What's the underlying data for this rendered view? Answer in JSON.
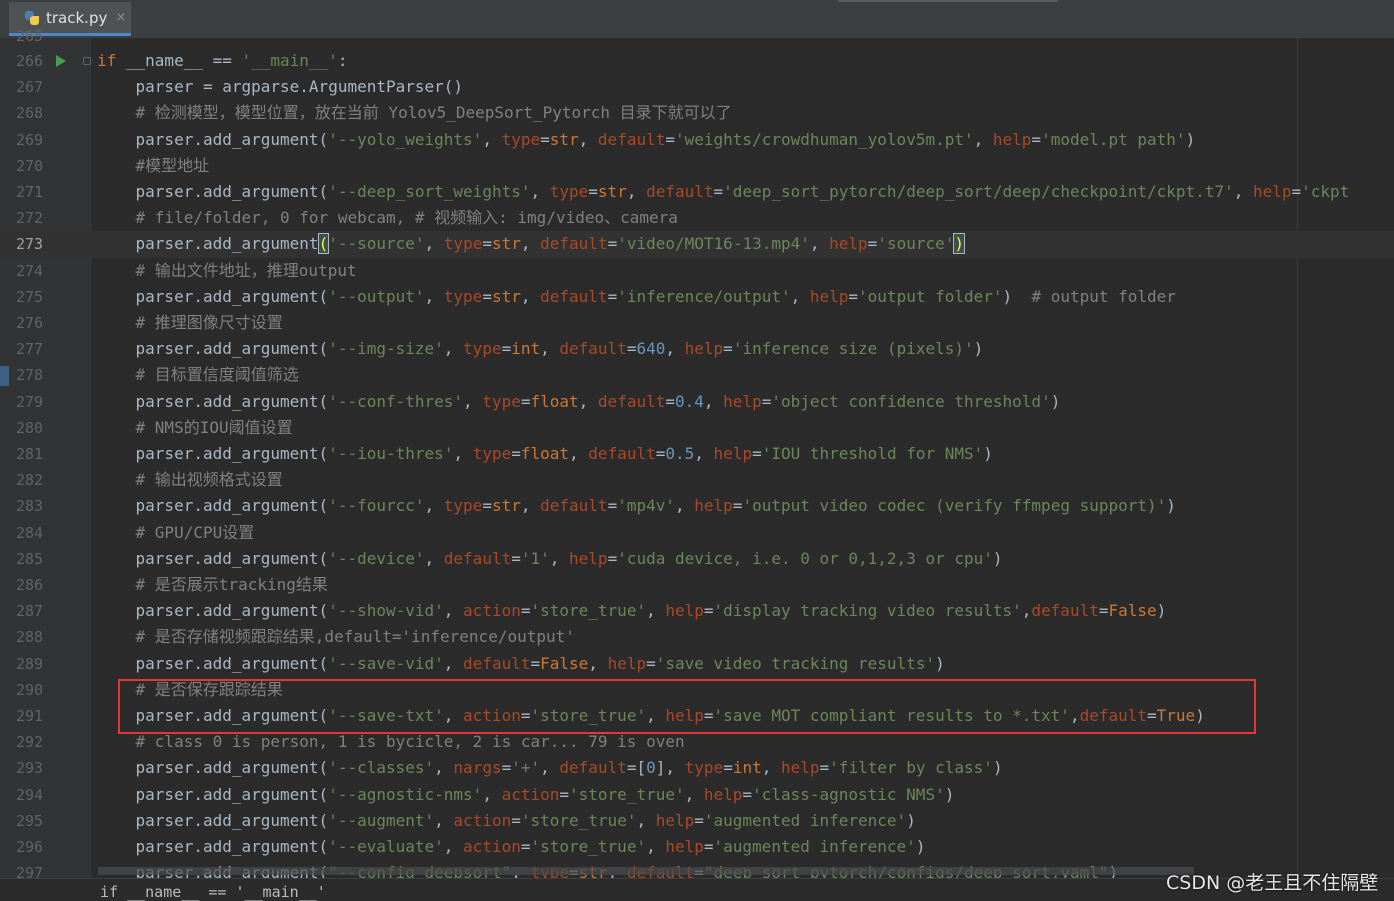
{
  "tab": {
    "file_name": "track.py",
    "close_glyph": "×",
    "icon": "python-file-icon"
  },
  "gutter": {
    "previous_line_number": "265",
    "current_line": "273"
  },
  "lines": [
    {
      "n": "266",
      "tokens": [
        [
          "kw",
          "if"
        ],
        [
          "fn",
          " __name__ == "
        ],
        [
          "str",
          "'__main__'"
        ],
        [
          "fn",
          ":"
        ]
      ]
    },
    {
      "n": "267",
      "tokens": [
        [
          "fn",
          "    parser = argparse.ArgumentParser()"
        ]
      ]
    },
    {
      "n": "268",
      "tokens": [
        [
          "com",
          "    # 检测模型，模型位置，放在当前 "
        ],
        [
          "com",
          "Yolov5_DeepSort_Pytorch"
        ],
        [
          "com",
          " 目录下就可以了"
        ]
      ]
    },
    {
      "n": "269",
      "tokens": [
        [
          "fn",
          "    parser.add_argument("
        ],
        [
          "str",
          "'--yolo_weights'"
        ],
        [
          "fn",
          ", "
        ],
        [
          "kwarg",
          "type"
        ],
        [
          "fn",
          "="
        ],
        [
          "kw2",
          "str"
        ],
        [
          "fn",
          ", "
        ],
        [
          "kwarg",
          "default"
        ],
        [
          "fn",
          "="
        ],
        [
          "str",
          "'weights/crowdhuman_yolov5m.pt'"
        ],
        [
          "fn",
          ", "
        ],
        [
          "kwarg",
          "help"
        ],
        [
          "fn",
          "="
        ],
        [
          "str",
          "'model.pt path'"
        ],
        [
          "fn",
          ")"
        ]
      ]
    },
    {
      "n": "270",
      "tokens": [
        [
          "com",
          "    #模型地址"
        ]
      ]
    },
    {
      "n": "271",
      "tokens": [
        [
          "fn",
          "    parser.add_argument("
        ],
        [
          "str",
          "'--deep_sort_weights'"
        ],
        [
          "fn",
          ", "
        ],
        [
          "kwarg",
          "type"
        ],
        [
          "fn",
          "="
        ],
        [
          "kw2",
          "str"
        ],
        [
          "fn",
          ", "
        ],
        [
          "kwarg",
          "default"
        ],
        [
          "fn",
          "="
        ],
        [
          "str",
          "'deep_sort_pytorch/deep_sort/deep/checkpoint/ckpt.t7'"
        ],
        [
          "fn",
          ", "
        ],
        [
          "kwarg",
          "help"
        ],
        [
          "fn",
          "="
        ],
        [
          "str",
          "'ckpt"
        ]
      ]
    },
    {
      "n": "272",
      "tokens": [
        [
          "com",
          "    # file/folder, 0 for webcam, # 视频输入: img/video、camera"
        ]
      ]
    },
    {
      "n": "273",
      "tokens": [
        [
          "fn",
          "    parser.add_argument"
        ],
        [
          "bm",
          "("
        ],
        [
          "str",
          "'--source'"
        ],
        [
          "fn",
          ", "
        ],
        [
          "kwarg",
          "type"
        ],
        [
          "fn",
          "="
        ],
        [
          "kw2",
          "str"
        ],
        [
          "fn",
          ", "
        ],
        [
          "kwarg",
          "default"
        ],
        [
          "fn",
          "="
        ],
        [
          "str",
          "'video/MOT16-13.mp4'"
        ],
        [
          "fn",
          ", "
        ],
        [
          "kwarg",
          "help"
        ],
        [
          "fn",
          "="
        ],
        [
          "str",
          "'source'"
        ],
        [
          "bm",
          ")"
        ]
      ]
    },
    {
      "n": "274",
      "tokens": [
        [
          "com",
          "    # 输出文件地址，推理output"
        ]
      ]
    },
    {
      "n": "275",
      "tokens": [
        [
          "fn",
          "    parser.add_argument("
        ],
        [
          "str",
          "'--output'"
        ],
        [
          "fn",
          ", "
        ],
        [
          "kwarg",
          "type"
        ],
        [
          "fn",
          "="
        ],
        [
          "kw2",
          "str"
        ],
        [
          "fn",
          ", "
        ],
        [
          "kwarg",
          "default"
        ],
        [
          "fn",
          "="
        ],
        [
          "str",
          "'inference/output'"
        ],
        [
          "fn",
          ", "
        ],
        [
          "kwarg",
          "help"
        ],
        [
          "fn",
          "="
        ],
        [
          "str",
          "'output folder'"
        ],
        [
          "fn",
          ")  "
        ],
        [
          "com",
          "# output folder"
        ]
      ]
    },
    {
      "n": "276",
      "tokens": [
        [
          "com",
          "    # 推理图像尺寸设置"
        ]
      ]
    },
    {
      "n": "277",
      "tokens": [
        [
          "fn",
          "    parser.add_argument("
        ],
        [
          "str",
          "'--img-size'"
        ],
        [
          "fn",
          ", "
        ],
        [
          "kwarg",
          "type"
        ],
        [
          "fn",
          "="
        ],
        [
          "kw2",
          "int"
        ],
        [
          "fn",
          ", "
        ],
        [
          "kwarg",
          "default"
        ],
        [
          "fn",
          "="
        ],
        [
          "num",
          "640"
        ],
        [
          "fn",
          ", "
        ],
        [
          "kwarg",
          "help"
        ],
        [
          "fn",
          "="
        ],
        [
          "str",
          "'inference size (pixels)'"
        ],
        [
          "fn",
          ")"
        ]
      ]
    },
    {
      "n": "278",
      "tokens": [
        [
          "com",
          "    # 目标置信度阈值筛选"
        ]
      ]
    },
    {
      "n": "279",
      "tokens": [
        [
          "fn",
          "    parser.add_argument("
        ],
        [
          "str",
          "'--conf-thres'"
        ],
        [
          "fn",
          ", "
        ],
        [
          "kwarg",
          "type"
        ],
        [
          "fn",
          "="
        ],
        [
          "kw2",
          "float"
        ],
        [
          "fn",
          ", "
        ],
        [
          "kwarg",
          "default"
        ],
        [
          "fn",
          "="
        ],
        [
          "num",
          "0.4"
        ],
        [
          "fn",
          ", "
        ],
        [
          "kwarg",
          "help"
        ],
        [
          "fn",
          "="
        ],
        [
          "str",
          "'object confidence threshold'"
        ],
        [
          "fn",
          ")"
        ]
      ]
    },
    {
      "n": "280",
      "tokens": [
        [
          "com",
          "    # NMS的IOU阈值设置"
        ]
      ]
    },
    {
      "n": "281",
      "tokens": [
        [
          "fn",
          "    parser.add_argument("
        ],
        [
          "str",
          "'--iou-thres'"
        ],
        [
          "fn",
          ", "
        ],
        [
          "kwarg",
          "type"
        ],
        [
          "fn",
          "="
        ],
        [
          "kw2",
          "float"
        ],
        [
          "fn",
          ", "
        ],
        [
          "kwarg",
          "default"
        ],
        [
          "fn",
          "="
        ],
        [
          "num",
          "0.5"
        ],
        [
          "fn",
          ", "
        ],
        [
          "kwarg",
          "help"
        ],
        [
          "fn",
          "="
        ],
        [
          "str",
          "'IOU threshold for NMS'"
        ],
        [
          "fn",
          ")"
        ]
      ]
    },
    {
      "n": "282",
      "tokens": [
        [
          "com",
          "    # 输出视频格式设置"
        ]
      ]
    },
    {
      "n": "283",
      "tokens": [
        [
          "fn",
          "    parser.add_argument("
        ],
        [
          "str",
          "'--fourcc'"
        ],
        [
          "fn",
          ", "
        ],
        [
          "kwarg",
          "type"
        ],
        [
          "fn",
          "="
        ],
        [
          "kw2",
          "str"
        ],
        [
          "fn",
          ", "
        ],
        [
          "kwarg",
          "default"
        ],
        [
          "fn",
          "="
        ],
        [
          "str",
          "'mp4v'"
        ],
        [
          "fn",
          ", "
        ],
        [
          "kwarg",
          "help"
        ],
        [
          "fn",
          "="
        ],
        [
          "str",
          "'output video codec (verify ffmpeg support)'"
        ],
        [
          "fn",
          ")"
        ]
      ]
    },
    {
      "n": "284",
      "tokens": [
        [
          "com",
          "    # GPU/CPU设置"
        ]
      ]
    },
    {
      "n": "285",
      "tokens": [
        [
          "fn",
          "    parser.add_argument("
        ],
        [
          "str",
          "'--device'"
        ],
        [
          "fn",
          ", "
        ],
        [
          "kwarg",
          "default"
        ],
        [
          "fn",
          "="
        ],
        [
          "str",
          "'1'"
        ],
        [
          "fn",
          ", "
        ],
        [
          "kwarg",
          "help"
        ],
        [
          "fn",
          "="
        ],
        [
          "str",
          "'cuda device, i.e. 0 or 0,1,2,3 or cpu'"
        ],
        [
          "fn",
          ")"
        ]
      ]
    },
    {
      "n": "286",
      "tokens": [
        [
          "com",
          "    # 是否展示tracking结果"
        ]
      ]
    },
    {
      "n": "287",
      "tokens": [
        [
          "fn",
          "    parser.add_argument("
        ],
        [
          "str",
          "'--show-vid'"
        ],
        [
          "fn",
          ", "
        ],
        [
          "kwarg",
          "action"
        ],
        [
          "fn",
          "="
        ],
        [
          "str",
          "'store_true'"
        ],
        [
          "fn",
          ", "
        ],
        [
          "kwarg",
          "help"
        ],
        [
          "fn",
          "="
        ],
        [
          "str",
          "'display tracking video results'"
        ],
        [
          "fn",
          ","
        ],
        [
          "kwarg",
          "default"
        ],
        [
          "fn",
          "="
        ],
        [
          "kw",
          "False"
        ],
        [
          "fn",
          ")"
        ]
      ]
    },
    {
      "n": "288",
      "tokens": [
        [
          "com",
          "    # 是否存储视频跟踪结果,default='inference/output'"
        ]
      ]
    },
    {
      "n": "289",
      "tokens": [
        [
          "fn",
          "    parser.add_argument("
        ],
        [
          "str",
          "'--save-vid'"
        ],
        [
          "fn",
          ", "
        ],
        [
          "kwarg",
          "default"
        ],
        [
          "fn",
          "="
        ],
        [
          "kw",
          "False"
        ],
        [
          "fn",
          ", "
        ],
        [
          "kwarg",
          "help"
        ],
        [
          "fn",
          "="
        ],
        [
          "str",
          "'save video tracking results'"
        ],
        [
          "fn",
          ")"
        ]
      ]
    },
    {
      "n": "290",
      "tokens": [
        [
          "com",
          "    # 是否保存跟踪结果"
        ]
      ]
    },
    {
      "n": "291",
      "tokens": [
        [
          "fn",
          "    parser.add_argument("
        ],
        [
          "str",
          "'--save-txt'"
        ],
        [
          "fn",
          ", "
        ],
        [
          "kwarg",
          "action"
        ],
        [
          "fn",
          "="
        ],
        [
          "str",
          "'store_true'"
        ],
        [
          "fn",
          ", "
        ],
        [
          "kwarg",
          "help"
        ],
        [
          "fn",
          "="
        ],
        [
          "str",
          "'save MOT compliant results to *.txt'"
        ],
        [
          "fn",
          ","
        ],
        [
          "kwarg",
          "default"
        ],
        [
          "fn",
          "="
        ],
        [
          "kw",
          "True"
        ],
        [
          "fn",
          ")"
        ]
      ]
    },
    {
      "n": "292",
      "tokens": [
        [
          "com",
          "    # class 0 is person, 1 is bycicle, 2 is car... 79 is oven"
        ]
      ]
    },
    {
      "n": "293",
      "tokens": [
        [
          "fn",
          "    parser.add_argument("
        ],
        [
          "str",
          "'--classes'"
        ],
        [
          "fn",
          ", "
        ],
        [
          "kwarg",
          "nargs"
        ],
        [
          "fn",
          "="
        ],
        [
          "str",
          "'+'"
        ],
        [
          "fn",
          ", "
        ],
        [
          "kwarg",
          "default"
        ],
        [
          "fn",
          "=["
        ],
        [
          "num",
          "0"
        ],
        [
          "fn",
          "], "
        ],
        [
          "kwarg",
          "type"
        ],
        [
          "fn",
          "="
        ],
        [
          "kw2",
          "int"
        ],
        [
          "fn",
          ", "
        ],
        [
          "kwarg",
          "help"
        ],
        [
          "fn",
          "="
        ],
        [
          "str",
          "'filter by class'"
        ],
        [
          "fn",
          ")"
        ]
      ]
    },
    {
      "n": "294",
      "tokens": [
        [
          "fn",
          "    parser.add_argument("
        ],
        [
          "str",
          "'--agnostic-nms'"
        ],
        [
          "fn",
          ", "
        ],
        [
          "kwarg",
          "action"
        ],
        [
          "fn",
          "="
        ],
        [
          "str",
          "'store_true'"
        ],
        [
          "fn",
          ", "
        ],
        [
          "kwarg",
          "help"
        ],
        [
          "fn",
          "="
        ],
        [
          "str",
          "'class-agnostic NMS'"
        ],
        [
          "fn",
          ")"
        ]
      ]
    },
    {
      "n": "295",
      "tokens": [
        [
          "fn",
          "    parser.add_argument("
        ],
        [
          "str",
          "'--augment'"
        ],
        [
          "fn",
          ", "
        ],
        [
          "kwarg",
          "action"
        ],
        [
          "fn",
          "="
        ],
        [
          "str",
          "'store_true'"
        ],
        [
          "fn",
          ", "
        ],
        [
          "kwarg",
          "help"
        ],
        [
          "fn",
          "="
        ],
        [
          "str",
          "'augmented inference'"
        ],
        [
          "fn",
          ")"
        ]
      ]
    },
    {
      "n": "296",
      "tokens": [
        [
          "fn",
          "    parser.add_argument("
        ],
        [
          "str",
          "'--evaluate'"
        ],
        [
          "fn",
          ", "
        ],
        [
          "kwarg",
          "action"
        ],
        [
          "fn",
          "="
        ],
        [
          "str",
          "'store_true'"
        ],
        [
          "fn",
          ", "
        ],
        [
          "kwarg",
          "help"
        ],
        [
          "fn",
          "="
        ],
        [
          "str",
          "'augmented inference'"
        ],
        [
          "fn",
          ")"
        ]
      ]
    },
    {
      "n": "297",
      "tokens": [
        [
          "fn",
          "    parser.add_argument("
        ],
        [
          "str",
          "\"--config_deepsort\""
        ],
        [
          "fn",
          ", "
        ],
        [
          "kwarg",
          "type"
        ],
        [
          "fn",
          "="
        ],
        [
          "kw2",
          "str"
        ],
        [
          "fn",
          ", "
        ],
        [
          "kwarg",
          "default"
        ],
        [
          "fn",
          "="
        ],
        [
          "str",
          "\"deep_sort_pytorch/configs/deep_sort.yaml\""
        ],
        [
          "fn",
          ")"
        ]
      ]
    }
  ],
  "breadcrumb": {
    "text": "if __name__ == '__main__'"
  },
  "watermark": {
    "text": "CSDN @老王且不住隔壁"
  },
  "colors": {
    "background": "#2b2b2b",
    "keyword": "#cc7832",
    "string": "#6a8759",
    "comment": "#808080",
    "number": "#6897bb",
    "kwarg": "#aa4926",
    "highlight_box": "#e0383b"
  }
}
